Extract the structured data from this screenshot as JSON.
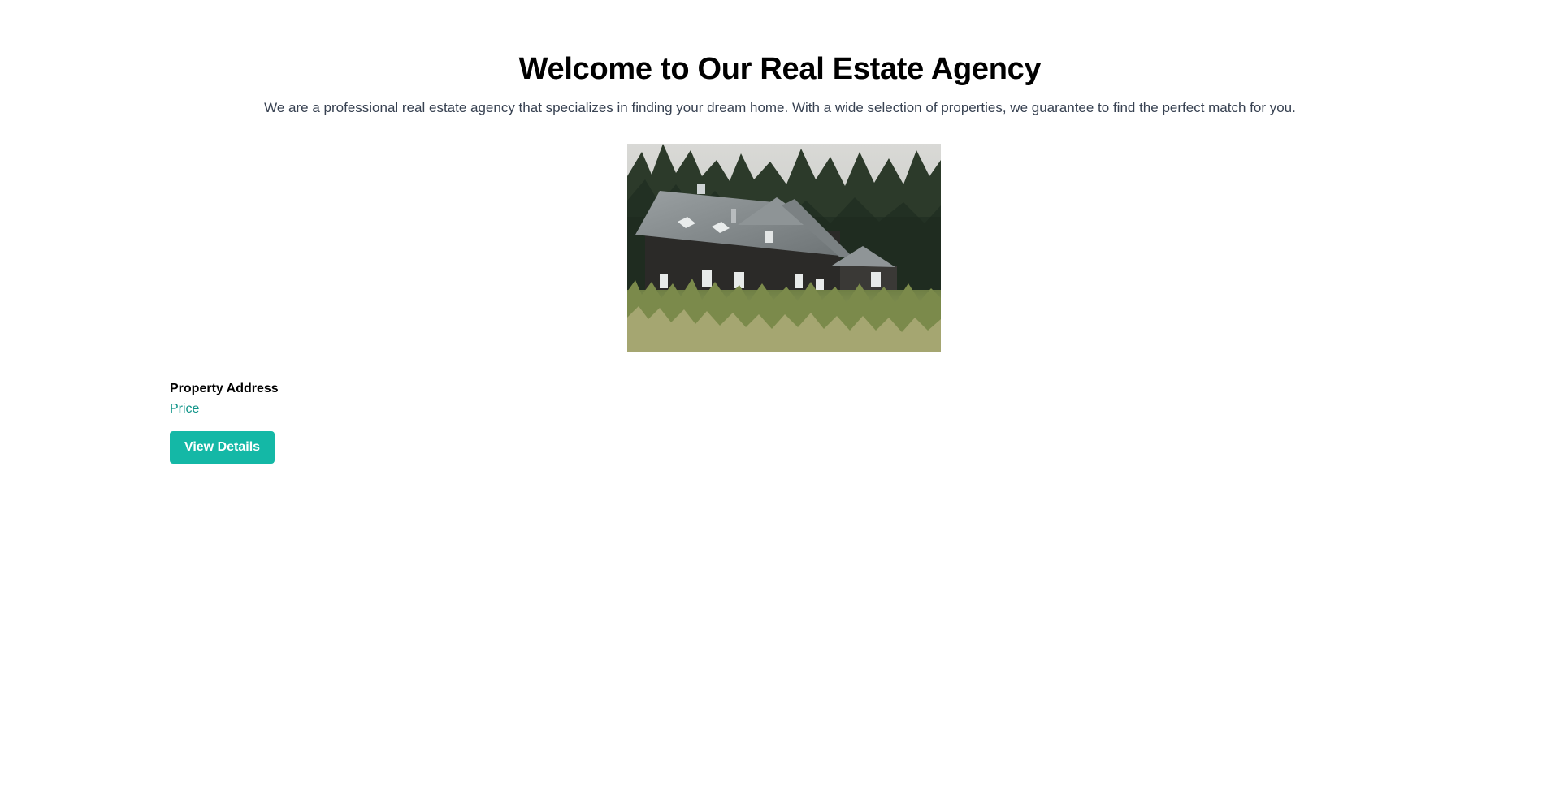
{
  "hero": {
    "title": "Welcome to Our Real Estate Agency",
    "description": "We are a professional real estate agency that specializes in finding your dream home. With a wide selection of properties, we guarantee to find the perfect match for you."
  },
  "property": {
    "image_subject": "dark wooden house with grey roof among pine trees and tall grass",
    "address_label": "Property Address",
    "price_label": "Price",
    "button_label": "View Details"
  },
  "colors": {
    "accent": "#14b8a6",
    "price_text": "#0f9488",
    "subtitle_text": "#374151"
  }
}
